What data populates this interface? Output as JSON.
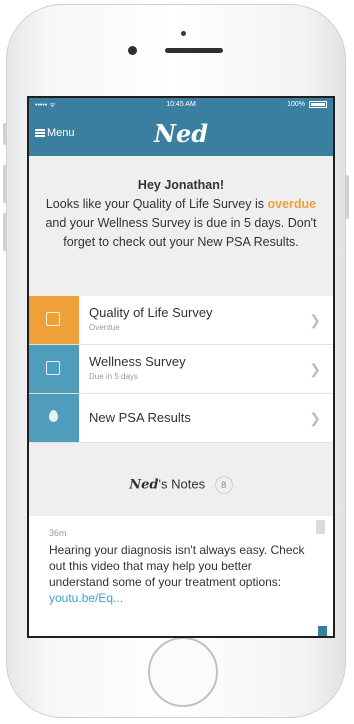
{
  "status_bar": {
    "carrier": "••••• ᯤ",
    "time": "10:45 AM",
    "battery": "100%"
  },
  "nav": {
    "menu_label": "Menu",
    "title": "Ned"
  },
  "greeting": {
    "hello": "Hey Jonathan!",
    "line_before": "Looks like your Quality of Life Survey is ",
    "overdue_word": "overdue",
    "line_after": " and your Wellness Survey is due in 5 days. Don't forget to check out your New PSA Results."
  },
  "tasks": [
    {
      "title": "Quality of Life Survey",
      "subtitle": "Overdue",
      "color": "#f0a038",
      "icon": "survey-icon"
    },
    {
      "title": "Wellness Survey",
      "subtitle": "Due in 5 days",
      "color": "#4f9cbb",
      "icon": "survey-icon"
    },
    {
      "title": "New PSA Results",
      "subtitle": "",
      "color": "#4f9cbb",
      "icon": "drop-icon"
    }
  ],
  "notes": {
    "brand": "Ned",
    "suffix": "'s Notes",
    "count": "8",
    "card": {
      "time": "36m",
      "text": "Hearing your diagnosis isn't always easy. Check out this video that may help you better understand some of your treatment options: ",
      "link": "youtu.be/Eq..."
    }
  },
  "colors": {
    "brand": "#3b7fa0",
    "overdue": "#f0a038",
    "link": "#3b9fd6"
  }
}
